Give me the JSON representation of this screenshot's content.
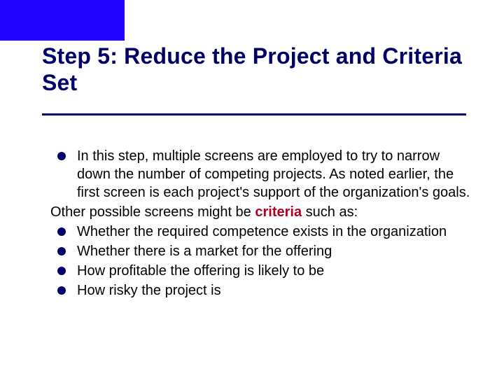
{
  "slide": {
    "title": "Step 5: Reduce the Project and Criteria Set",
    "para1": "In this step, multiple screens are employed to try to narrow down the number of competing projects. As noted earlier, the first screen is each project's support of the organization's goals.",
    "transition_pre": "Other possible screens might be ",
    "transition_bold": "criteria",
    "transition_post": " such as:",
    "bullets": {
      "b1": "Whether the required competence exists in the organization",
      "b2": "Whether there is a market for the offering",
      "b3": "How profitable the offering is likely to be",
      "b4": "How risky the project is"
    }
  }
}
